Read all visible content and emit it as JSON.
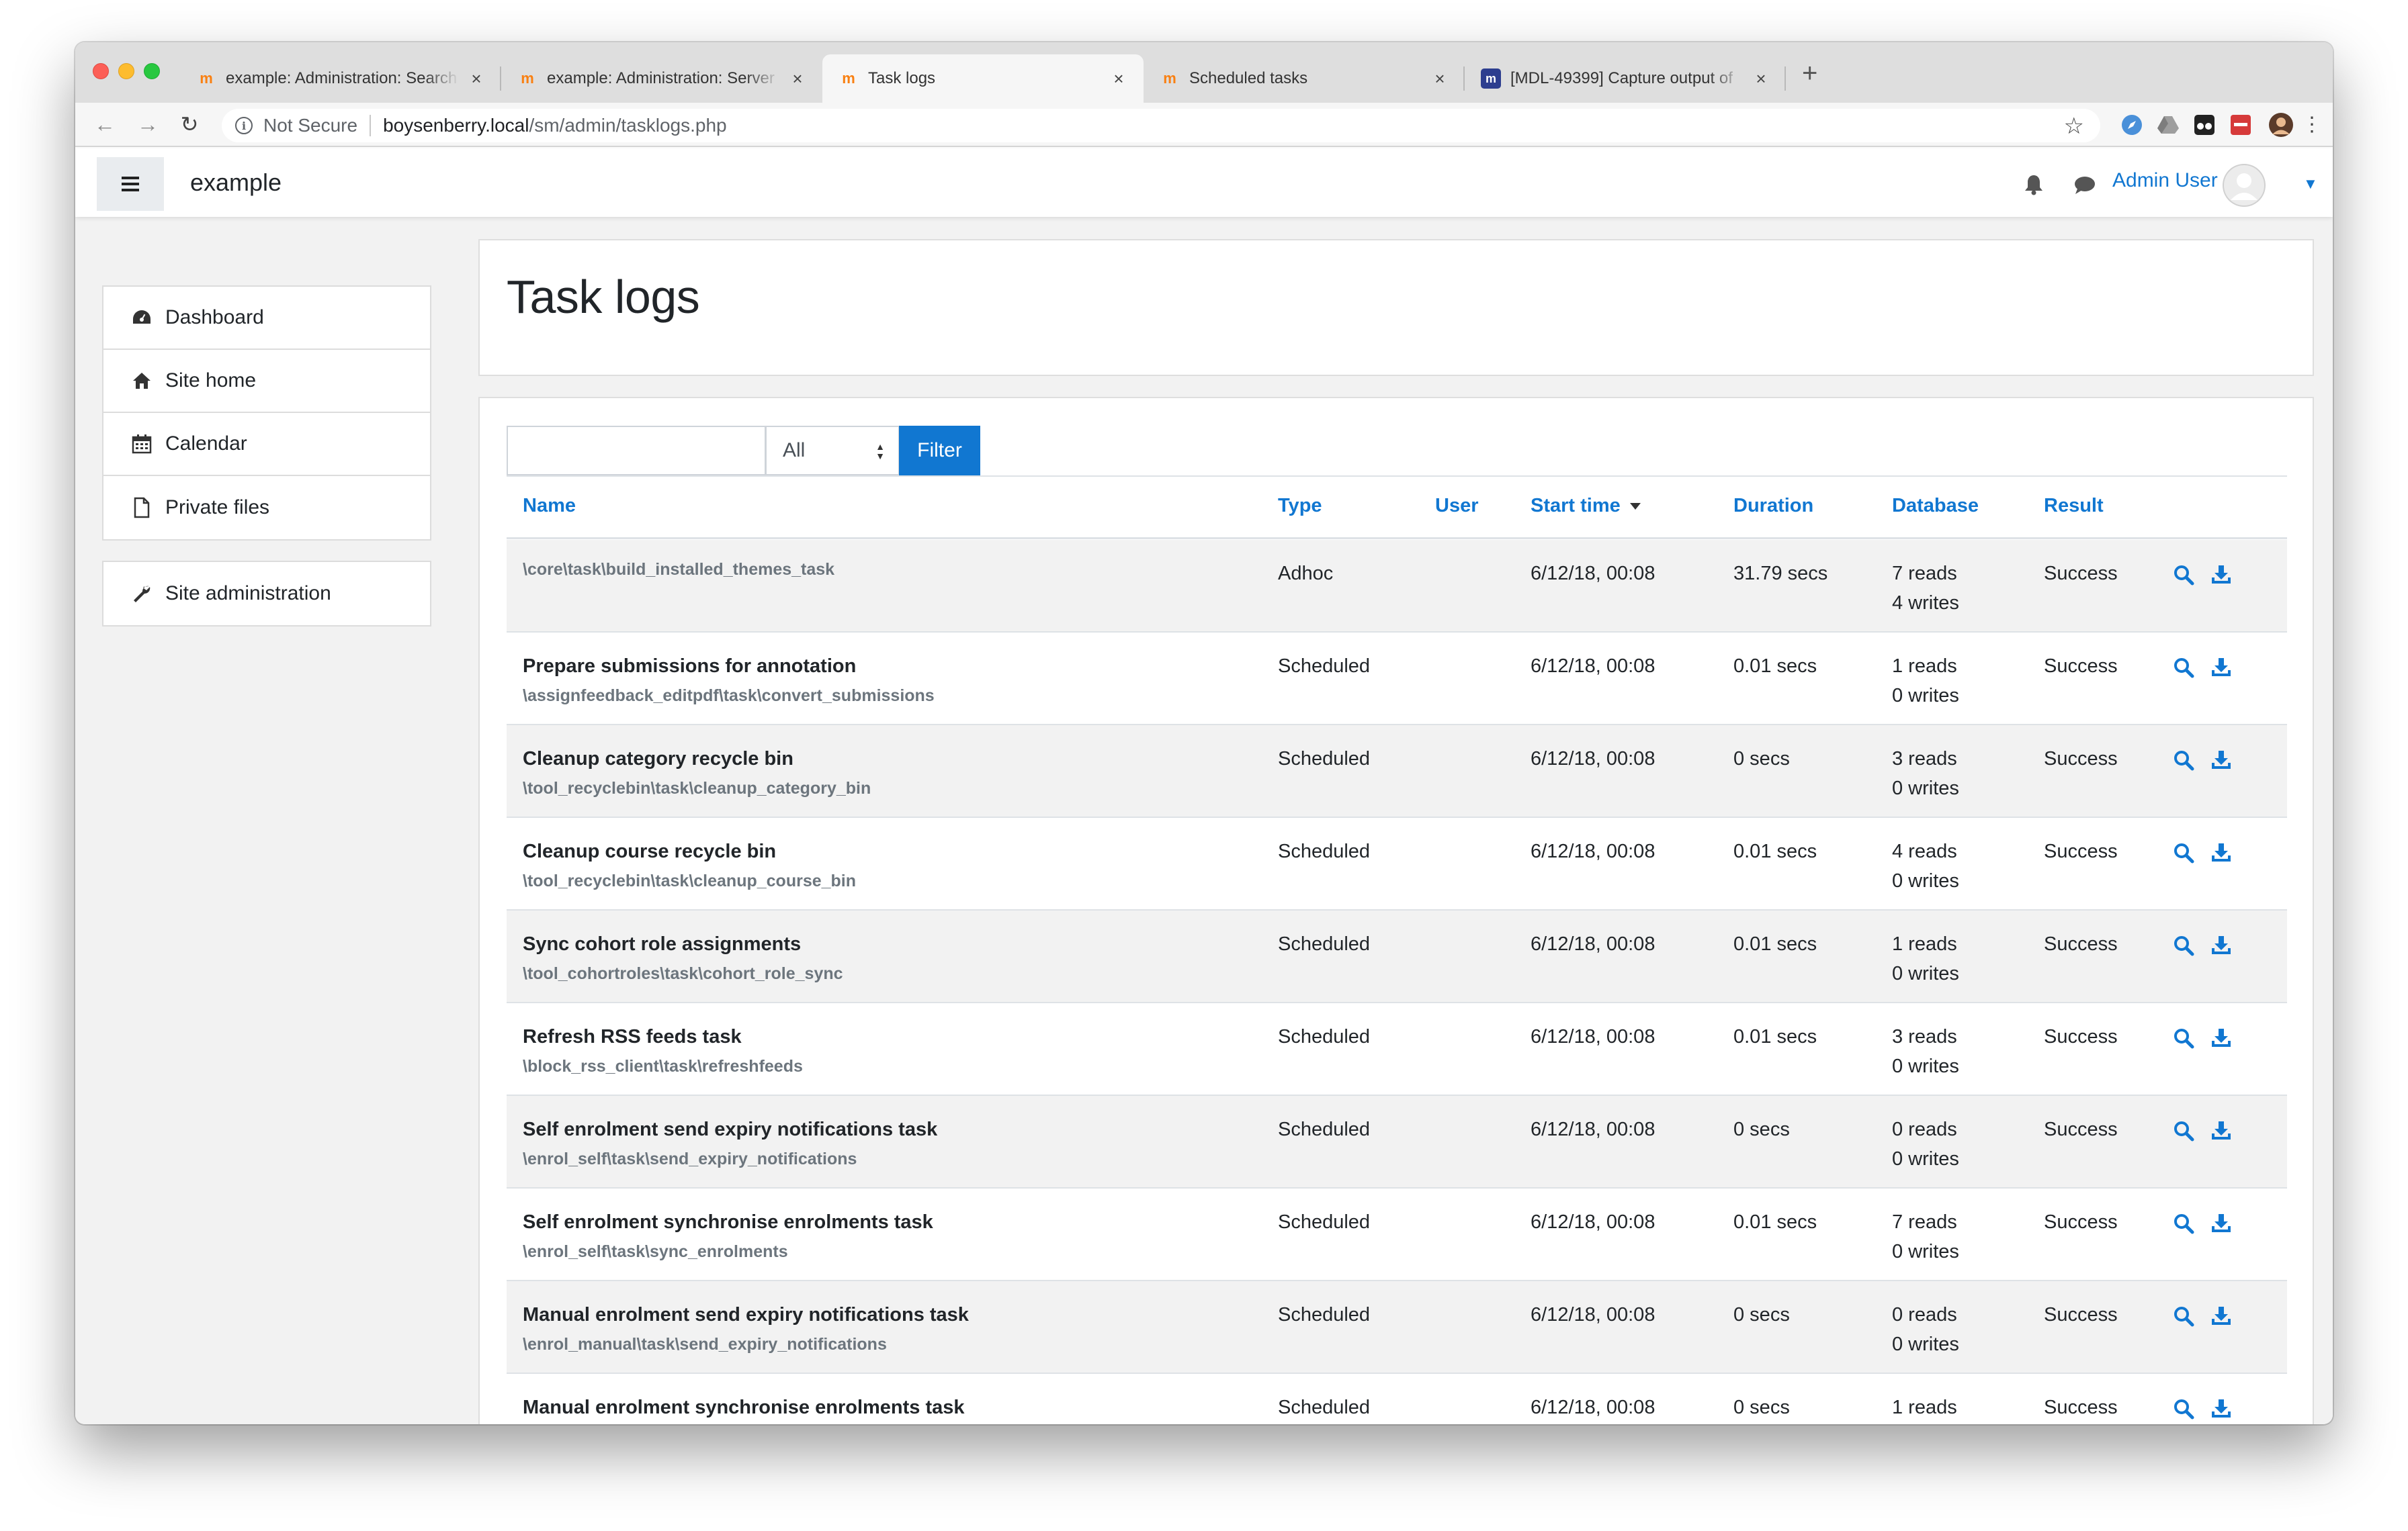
{
  "browser": {
    "tabs": [
      {
        "title": "example: Administration: Search",
        "favicon": "moodle-icon",
        "active": false
      },
      {
        "title": "example: Administration: Server",
        "favicon": "moodle-icon",
        "active": false
      },
      {
        "title": "Task logs",
        "favicon": "moodle-icon",
        "active": true
      },
      {
        "title": "Scheduled tasks",
        "favicon": "moodle-icon",
        "active": false
      },
      {
        "title": "[MDL-49399] Capture output of",
        "favicon": "jira-icon",
        "active": false
      }
    ],
    "address": {
      "security": "Not Secure",
      "host": "boysenberry.local",
      "path": "/sm/admin/tasklogs.php"
    }
  },
  "navbar": {
    "brand": "example",
    "user": "Admin User"
  },
  "sidebar": {
    "items": [
      {
        "label": "Dashboard",
        "icon": "dashboard-icon"
      },
      {
        "label": "Site home",
        "icon": "home-icon"
      },
      {
        "label": "Calendar",
        "icon": "calendar-icon"
      },
      {
        "label": "Private files",
        "icon": "file-icon"
      }
    ],
    "admin": {
      "label": "Site administration",
      "icon": "wrench-icon"
    }
  },
  "page": {
    "title": "Task logs"
  },
  "filter": {
    "input_value": "",
    "select_value": "All",
    "button_label": "Filter"
  },
  "table": {
    "headers": {
      "name": "Name",
      "type": "Type",
      "user": "User",
      "start_time": "Start time",
      "duration": "Duration",
      "database": "Database",
      "result": "Result"
    },
    "rows": [
      {
        "name": "",
        "classname": "\\core\\task\\build_installed_themes_task",
        "type": "Adhoc",
        "user": "",
        "start": "6/12/18, 00:08",
        "duration": "31.79 secs",
        "reads": "7 reads",
        "writes": "4 writes",
        "result": "Success"
      },
      {
        "name": "Prepare submissions for annotation",
        "classname": "\\assignfeedback_editpdf\\task\\convert_submissions",
        "type": "Scheduled",
        "user": "",
        "start": "6/12/18, 00:08",
        "duration": "0.01 secs",
        "reads": "1 reads",
        "writes": "0 writes",
        "result": "Success"
      },
      {
        "name": "Cleanup category recycle bin",
        "classname": "\\tool_recyclebin\\task\\cleanup_category_bin",
        "type": "Scheduled",
        "user": "",
        "start": "6/12/18, 00:08",
        "duration": "0 secs",
        "reads": "3 reads",
        "writes": "0 writes",
        "result": "Success"
      },
      {
        "name": "Cleanup course recycle bin",
        "classname": "\\tool_recyclebin\\task\\cleanup_course_bin",
        "type": "Scheduled",
        "user": "",
        "start": "6/12/18, 00:08",
        "duration": "0.01 secs",
        "reads": "4 reads",
        "writes": "0 writes",
        "result": "Success"
      },
      {
        "name": "Sync cohort role assignments",
        "classname": "\\tool_cohortroles\\task\\cohort_role_sync",
        "type": "Scheduled",
        "user": "",
        "start": "6/12/18, 00:08",
        "duration": "0.01 secs",
        "reads": "1 reads",
        "writes": "0 writes",
        "result": "Success"
      },
      {
        "name": "Refresh RSS feeds task",
        "classname": "\\block_rss_client\\task\\refreshfeeds",
        "type": "Scheduled",
        "user": "",
        "start": "6/12/18, 00:08",
        "duration": "0.01 secs",
        "reads": "3 reads",
        "writes": "0 writes",
        "result": "Success"
      },
      {
        "name": "Self enrolment send expiry notifications task",
        "classname": "\\enrol_self\\task\\send_expiry_notifications",
        "type": "Scheduled",
        "user": "",
        "start": "6/12/18, 00:08",
        "duration": "0 secs",
        "reads": "0 reads",
        "writes": "0 writes",
        "result": "Success"
      },
      {
        "name": "Self enrolment synchronise enrolments task",
        "classname": "\\enrol_self\\task\\sync_enrolments",
        "type": "Scheduled",
        "user": "",
        "start": "6/12/18, 00:08",
        "duration": "0.01 secs",
        "reads": "7 reads",
        "writes": "0 writes",
        "result": "Success"
      },
      {
        "name": "Manual enrolment send expiry notifications task",
        "classname": "\\enrol_manual\\task\\send_expiry_notifications",
        "type": "Scheduled",
        "user": "",
        "start": "6/12/18, 00:08",
        "duration": "0 secs",
        "reads": "0 reads",
        "writes": "0 writes",
        "result": "Success"
      },
      {
        "name": "Manual enrolment synchronise enrolments task",
        "classname": "",
        "type": "Scheduled",
        "user": "",
        "start": "6/12/18, 00:08",
        "duration": "0 secs",
        "reads": "1 reads",
        "writes": "",
        "result": "Success"
      }
    ]
  },
  "colors": {
    "accent": "#1177d1",
    "page_bg": "#f2f2f2",
    "row_stripe": "#f2f2f2",
    "muted_text": "#6c757d"
  }
}
